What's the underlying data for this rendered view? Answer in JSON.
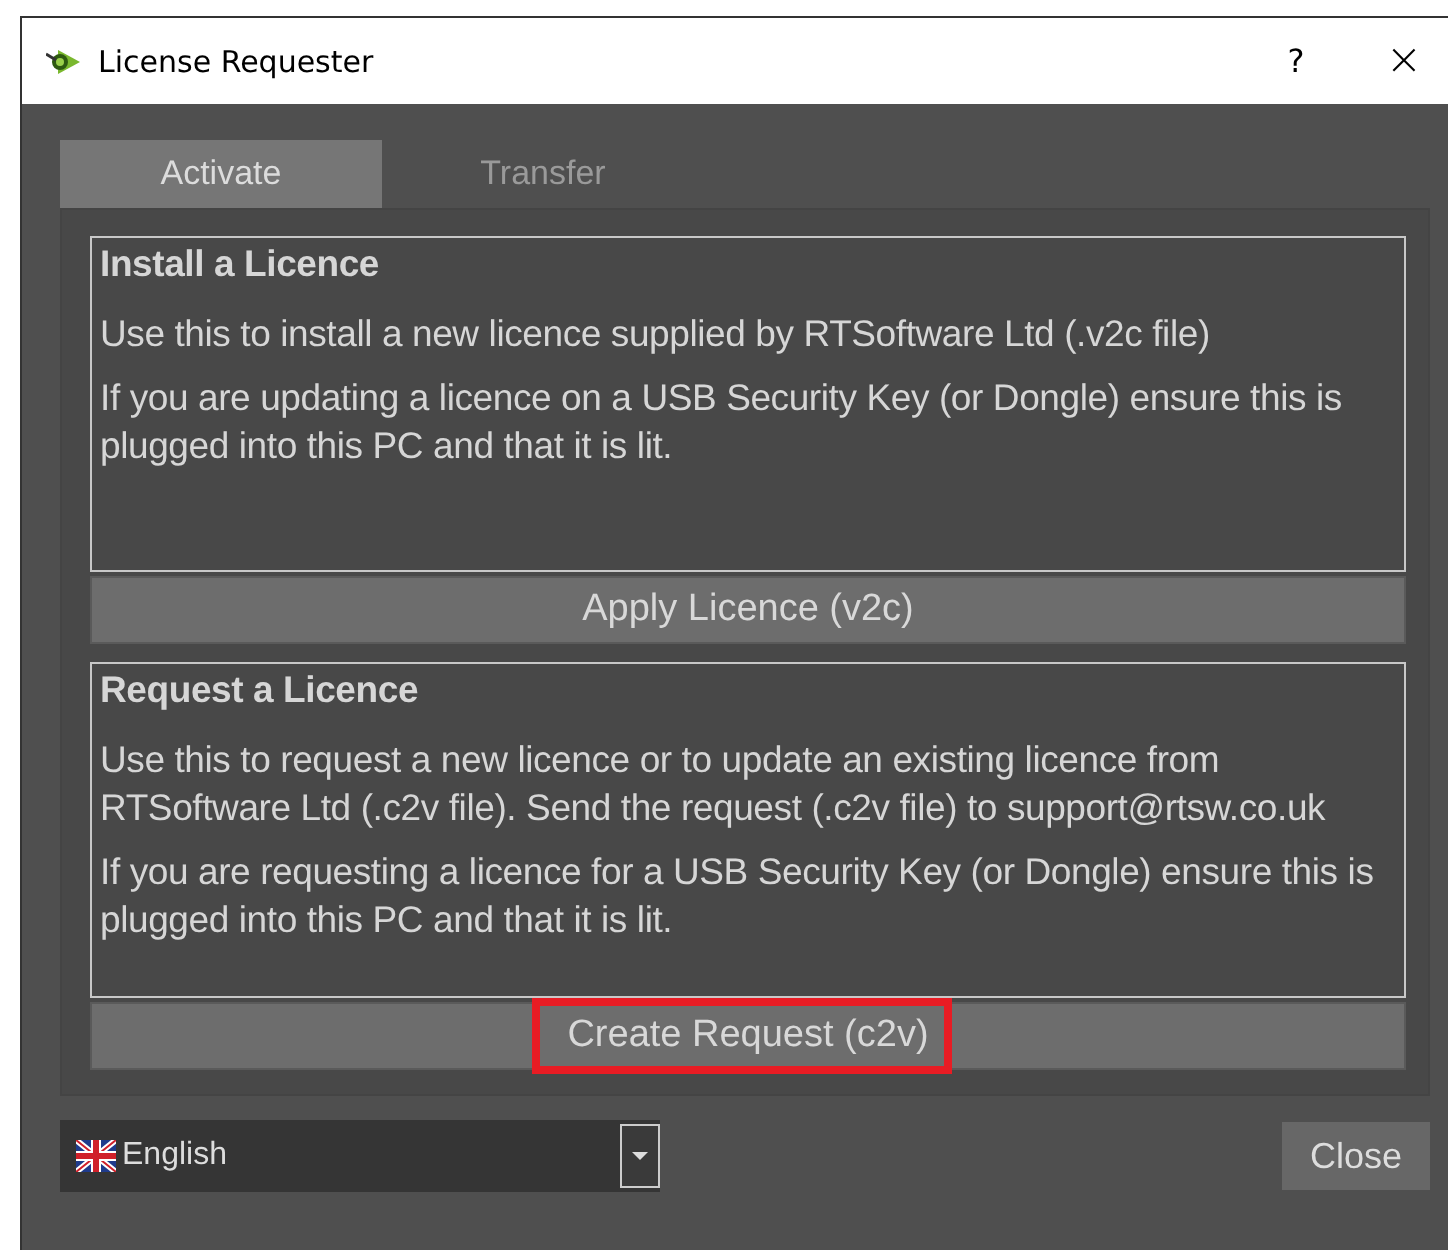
{
  "window": {
    "title": "License Requester",
    "help": "?",
    "close": "×"
  },
  "tabs": [
    {
      "label": "Activate",
      "selected": true
    },
    {
      "label": "Transfer",
      "selected": false
    }
  ],
  "sections": [
    {
      "heading": "Install a Licence",
      "paragraphs": [
        "Use this to install a new licence supplied by RTSoftware Ltd (.v2c file)",
        "If you are updating a licence on a USB Security Key (or Dongle) ensure this is plugged into this PC and that it is lit."
      ],
      "button": {
        "label": "Apply Licence (v2c)",
        "highlighted": false
      }
    },
    {
      "heading": "Request a Licence",
      "paragraphs": [
        "Use this to request a new licence or to update an existing licence from RTSoftware Ltd (.c2v file). Send the request (.c2v file) to support@rtsw.co.uk",
        "If you are requesting a licence for a USB Security Key (or Dongle) ensure this is plugged into this PC and that it is lit."
      ],
      "button": {
        "label": "Create Request (c2v)",
        "highlighted": true
      }
    }
  ],
  "language": {
    "value": "English"
  },
  "close_button": "Close"
}
